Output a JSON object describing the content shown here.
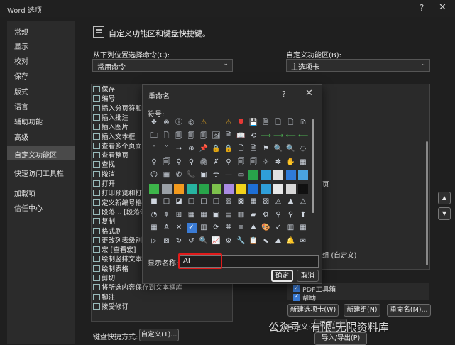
{
  "window": {
    "title": "Word 选项",
    "help": "?",
    "close": "✕"
  },
  "nav": {
    "items": [
      "常规",
      "显示",
      "校对",
      "保存",
      "版式",
      "语言",
      "辅助功能",
      "高级",
      "自定义功能区",
      "快速访问工具栏",
      "加载项",
      "信任中心"
    ],
    "active_index": 8
  },
  "header": {
    "title": "自定义功能区和键盘快捷键。"
  },
  "left": {
    "choose_label": "从下列位置选择命令(C):",
    "choose_value": "常用命令",
    "commands": [
      "保存",
      "编号",
      "插入分页符和",
      "插入批注",
      "插入图片",
      "插入文本框",
      "查看多个页面",
      "查看整页",
      "查找",
      "撤消",
      "打开",
      "打印预览和打",
      "定义新编号格",
      "段落... [段落设",
      "复制",
      "格式刷",
      "更改列表级别",
      "宏 [查看宏]",
      "绘制竖排文本",
      "绘制表格",
      "剪切",
      "将所选内容保存到文本框库",
      "脚注",
      "接受修订"
    ]
  },
  "right": {
    "label": "自定义功能区(B):",
    "value": "主选项卡",
    "partial_items": [
      "页",
      "",
      "组 (自定义)",
      "PDF工具箱",
      "帮助"
    ],
    "buttons": {
      "new_tab": "新建选项卡(W)",
      "new_group": "新建组(N)",
      "rename": "重命名(M)...",
      "customize": "自定义:",
      "reset": "重置(E)",
      "import_export": "导入/导出(P)"
    }
  },
  "keyboard": {
    "label": "键盘快捷方式:",
    "button": "自定义(T)..."
  },
  "dialog": {
    "title": "重命名",
    "help": "?",
    "close": "✕",
    "symbol_label": "符号:",
    "display_name_label": "显示名称:",
    "display_name_value": "AI",
    "ok": "确定",
    "cancel": "取消",
    "symbols": [
      [
        "⛖",
        "⊗",
        "ⓘ",
        "◎",
        "⚠",
        "!",
        "⚠",
        "⛊",
        "💾",
        "🗎",
        "🗋",
        "🗋",
        "🗈"
      ],
      [
        "🗀",
        "🗋",
        "🗐",
        "🗐",
        "🗐",
        "🖼",
        "🗎",
        "📖",
        "⟲",
        "⟶",
        "⟶",
        "⟵",
        "⟵"
      ],
      [
        "˄",
        "˅",
        "→",
        "⊕",
        "📌",
        "🔒",
        "🔒",
        "🗋",
        "🗎",
        "⚑",
        "🔍",
        "🔍",
        "◌"
      ],
      [
        "⚲",
        "🗐",
        "⚲",
        "⚲",
        "🖇",
        "✗",
        "⚲",
        "🗐",
        "🗐",
        "☼",
        "✽",
        "✋",
        "▦"
      ],
      [
        "☹",
        "▦",
        "✆",
        "📞",
        "▣",
        "ᯤ",
        "—",
        "▭",
        "■",
        "■",
        "■",
        "■",
        "■"
      ],
      [
        "■",
        "■",
        "■",
        "■",
        "■",
        "■",
        "■",
        "■",
        "■",
        "■",
        "◩",
        "■",
        "■"
      ],
      [
        "■",
        "□",
        "◪",
        "□",
        "□",
        "□",
        "▨",
        "▩",
        "▦",
        "▧",
        "◬",
        "▲",
        "△"
      ],
      [
        "◔",
        "✵",
        "⊞",
        "▦",
        "▦",
        "▣",
        "▤",
        "▥",
        "▰",
        "⚙",
        "⚲",
        "⚲",
        "⬆"
      ],
      [
        "▦",
        "A",
        "✕",
        "✓",
        "▥",
        "⟳",
        "⌘",
        "π",
        "⛰",
        "🎨",
        "✓",
        "▥",
        "▦"
      ],
      [
        "▷",
        "⊠",
        "↻",
        "↺",
        "🔍",
        "📈",
        "⚙",
        "🔧",
        "📋",
        "⬉",
        "⛰",
        "🔔",
        "✉"
      ]
    ]
  },
  "watermark": "公众号 · 有限-无限资料库",
  "colors": {
    "accent": "#3a7bd5",
    "highlight": "#e01b1b"
  }
}
